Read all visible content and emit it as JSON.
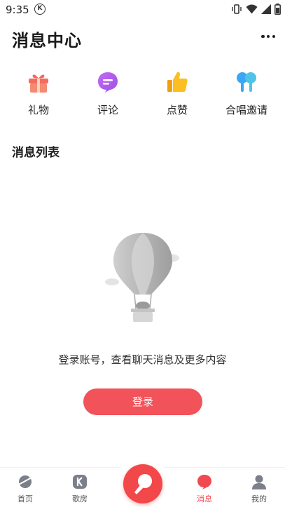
{
  "status": {
    "time": "9:35",
    "app_badge": "K"
  },
  "header": {
    "title": "消息中心",
    "more_icon": "more-dots-icon"
  },
  "categories": [
    {
      "label": "礼物",
      "icon": "gift-icon"
    },
    {
      "label": "评论",
      "icon": "comment-icon"
    },
    {
      "label": "点赞",
      "icon": "thumbs-up-icon"
    },
    {
      "label": "合唱邀请",
      "icon": "chorus-icon"
    }
  ],
  "section": {
    "title": "消息列表"
  },
  "empty_state": {
    "illustration": "hot-air-balloon-icon",
    "message": "登录账号，查看聊天消息及更多内容",
    "login_label": "登录"
  },
  "bottom_nav": {
    "items": [
      {
        "label": "首页",
        "icon": "home-planet-icon"
      },
      {
        "label": "歌房",
        "icon": "k-room-icon"
      },
      {
        "label": "",
        "icon": "microphone-icon"
      },
      {
        "label": "消息",
        "icon": "message-bubble-icon",
        "active": true
      },
      {
        "label": "我的",
        "icon": "profile-icon"
      }
    ]
  },
  "colors": {
    "accent": "#f25259",
    "gift": "#f5675c",
    "comment": "#b45cf0",
    "like": "#f7a814",
    "chorus": "#3aa6f5"
  }
}
